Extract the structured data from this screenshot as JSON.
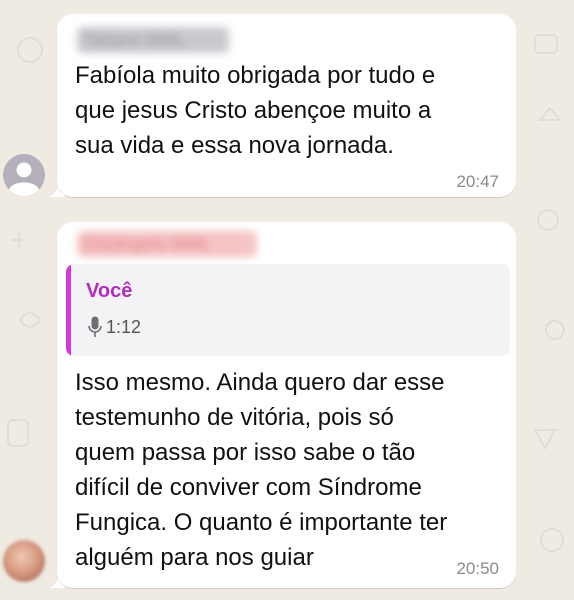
{
  "chat": {
    "messages": [
      {
        "sender": "Tatiane MML",
        "text": "Fabíola muito obrigada por tudo e\nque jesus Cristo abençoe muito a\nsua vida e essa nova jornada.",
        "time": "20:47"
      },
      {
        "sender": "Elisângela MML",
        "quote": {
          "author": "Você",
          "duration": "1:12",
          "icon": "mic-icon"
        },
        "text": "Isso mesmo. Ainda quero dar esse\ntestemunho de vitória, pois só\nquem passa por isso sabe o tão\ndifícil de conviver com Síndrome\nFungica. O quanto é importante ter\nalguém para nos guiar",
        "time": "20:50"
      }
    ]
  },
  "colors": {
    "background": "#efeae2",
    "bubble": "#ffffff",
    "quote_accent": "#d23bd9",
    "quote_author": "#b32cbd",
    "timestamp": "#8a8a8a"
  }
}
